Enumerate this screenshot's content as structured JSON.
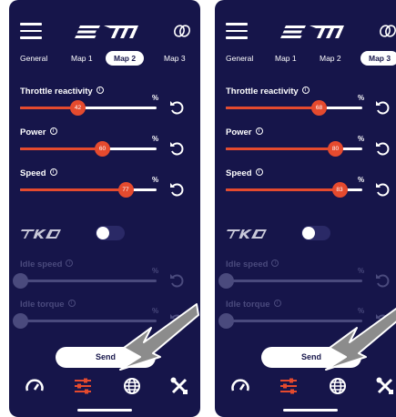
{
  "phones": [
    {
      "tabs": [
        "General",
        "Map 1",
        "Map 2",
        "Map 3"
      ],
      "active_tab": "Map 2",
      "sliders": [
        {
          "label": "Throttle reactivity",
          "unit": "%",
          "value": "42",
          "fraction": 0.42
        },
        {
          "label": "Power",
          "unit": "%",
          "value": "60",
          "fraction": 0.6
        },
        {
          "label": "Speed",
          "unit": "%",
          "value": "77",
          "fraction": 0.77
        }
      ],
      "disabled_sliders": [
        {
          "label": "Idle speed",
          "unit": "%"
        },
        {
          "label": "Idle torque",
          "unit": "%"
        }
      ],
      "send_label": "Send"
    },
    {
      "tabs": [
        "General",
        "Map 1",
        "Map 2",
        "Map 3"
      ],
      "active_tab": "Map 3",
      "sliders": [
        {
          "label": "Throttle reactivity",
          "unit": "%",
          "value": "68",
          "fraction": 0.68
        },
        {
          "label": "Power",
          "unit": "%",
          "value": "80",
          "fraction": 0.8
        },
        {
          "label": "Speed",
          "unit": "%",
          "value": "83",
          "fraction": 0.83
        }
      ],
      "disabled_sliders": [
        {
          "label": "Idle speed",
          "unit": "%"
        },
        {
          "label": "Idle torque",
          "unit": "%"
        }
      ],
      "send_label": "Send"
    }
  ],
  "icons": {
    "menu": "menu-icon",
    "logo": "em-logo",
    "link": "link-rings-icon",
    "reset": "reset-icon",
    "tko": "tko-logo",
    "nav": [
      "speedometer-icon",
      "sliders-icon",
      "globe-icon",
      "tools-icon"
    ]
  },
  "colors": {
    "background": "#16154a",
    "accent": "#e54a2e",
    "disabled": "#4a4a7d"
  }
}
